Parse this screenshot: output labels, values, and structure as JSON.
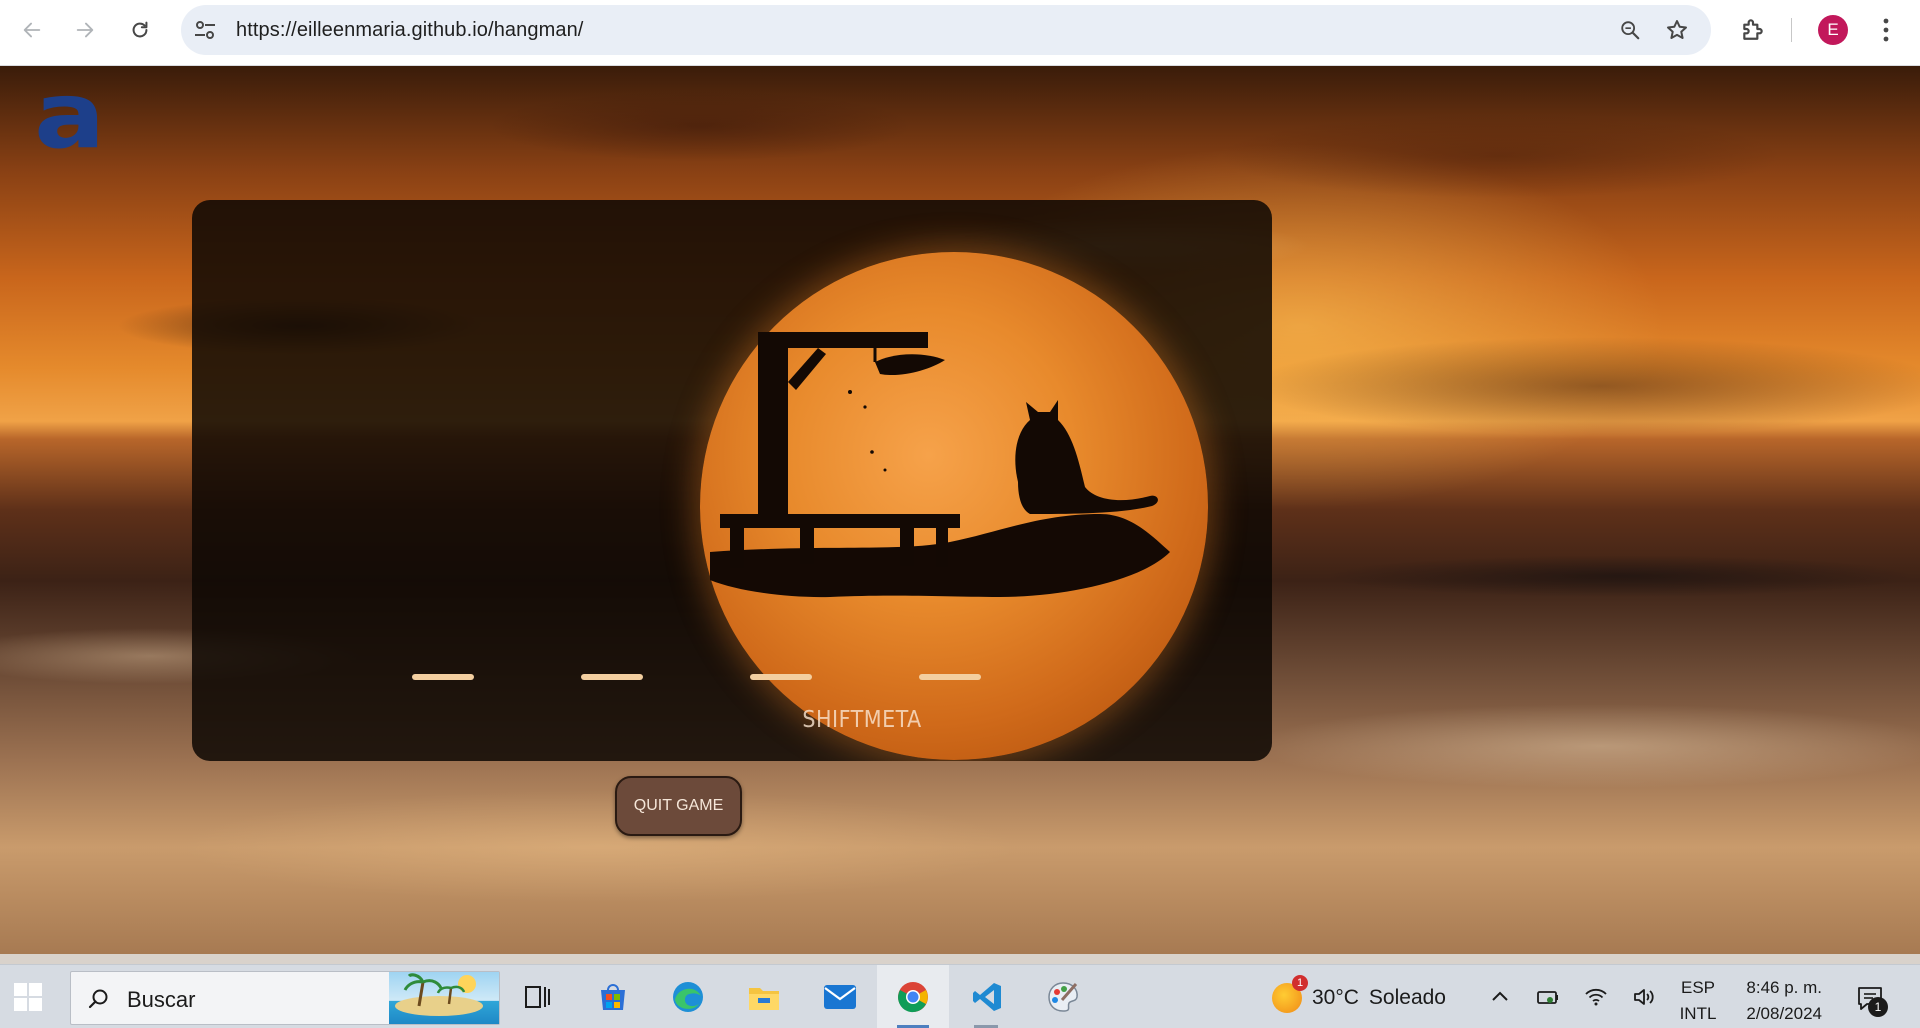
{
  "browser": {
    "url": "https://eilleenmaria.github.io/hangman/",
    "profile_initial": "E",
    "profile_color": "#c2185b",
    "icons": [
      "back-icon",
      "forward-icon",
      "reload-icon",
      "site-settings-icon",
      "zoom-icon",
      "bookmark-star-icon",
      "extensions-icon",
      "menu-dots-icon"
    ]
  },
  "page": {
    "logo_text": "a",
    "logo_color": "#1d3f8a",
    "game": {
      "letter_slots": 4,
      "brand_text": "SHIFTMETA"
    },
    "quit_button_label": "QUIT GAME"
  },
  "taskbar": {
    "search_label": "Buscar",
    "apps": [
      "task-view",
      "microsoft-store",
      "edge",
      "file-explorer",
      "mail",
      "chrome",
      "vscode",
      "paint"
    ],
    "active_app": "chrome",
    "weather": {
      "badge": "1",
      "temperature": "30°C",
      "condition": "Soleado"
    },
    "language": {
      "line1": "ESP",
      "line2": "INTL"
    },
    "clock": {
      "time": "8:46 p. m.",
      "date": "2/08/2024"
    },
    "notifications_count": "1"
  }
}
